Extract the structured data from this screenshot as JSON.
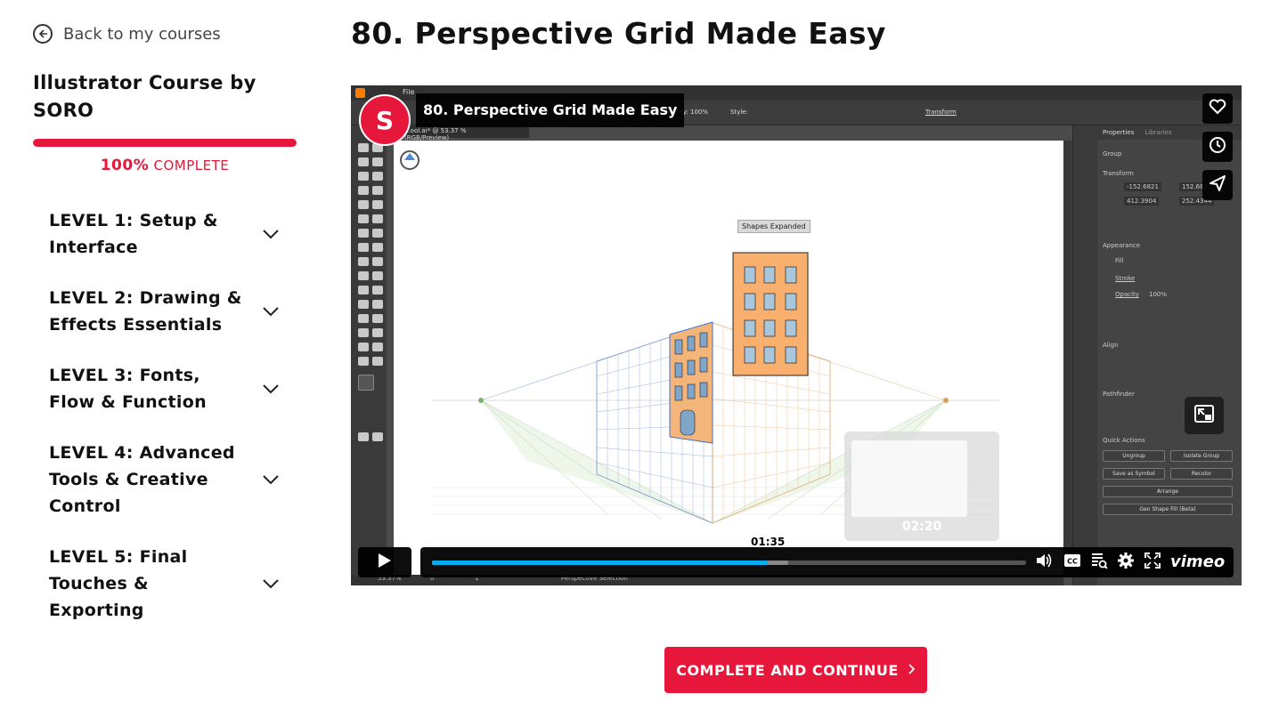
{
  "sidebar": {
    "back_label": "Back to my courses",
    "course_title": "Illustrator Course by SORO",
    "progress_fraction": 1.0,
    "progress_percent": "100%",
    "progress_word": "COMPLETE",
    "accent_color": "#e6173b",
    "levels": [
      {
        "label": "LEVEL 1: Setup & Interface"
      },
      {
        "label": "LEVEL 2: Drawing & Effects Essentials"
      },
      {
        "label": "LEVEL 3: Fonts, Flow & Function"
      },
      {
        "label": "LEVEL 4: Advanced Tools & Creative Control"
      },
      {
        "label": "LEVEL 5: Final Touches & Exporting"
      }
    ]
  },
  "lesson": {
    "title": "80. Perspective Grid Made Easy"
  },
  "player": {
    "overlay_title": "80. Perspective Grid Made Easy",
    "badge_logo_letter": "S",
    "current_time": "01:35",
    "preview_time": "02:20",
    "played_fraction": 0.565,
    "buffered_fraction": 0.6,
    "brand": "vimeo",
    "accent_color": "#00adef",
    "side_buttons": [
      "heart-icon",
      "clock-icon",
      "send-icon"
    ],
    "controls": [
      "volume-icon",
      "cc-icon",
      "chapters-icon",
      "settings-icon",
      "fullscreen-icon"
    ],
    "screen": {
      "menu_file": "File",
      "doc_tab": "...ool.ai* @ 53.37 % (RGB/Preview)",
      "tooltip": "Shapes Expanded",
      "zoom": "53.37%",
      "rotation": "0°",
      "artboard": "1",
      "status": "Perspective Selection",
      "props_tab_1": "Properties",
      "props_tab_2": "Libraries",
      "group_label": "Group",
      "transform_label": "Transform",
      "x_value": "-152.6821",
      "y_value": "412.3904",
      "w_value": "152.682",
      "h_value": "252.4344",
      "appearance_label": "Appearance",
      "fill_label": "Fill",
      "stroke_label": "Stroke",
      "opacity_label": "Opacity",
      "opacity_value": "100%",
      "align_label": "Align",
      "pathfinder_label": "Pathfinder",
      "quick_actions_label": "Quick Actions",
      "btn_ungroup": "Ungroup",
      "btn_isolate": "Isolate Group",
      "btn_symbol": "Save as Symbol",
      "btn_recolor": "Recolor",
      "btn_arrange": "Arrange",
      "btn_genshape": "Gen Shape Fill (Beta)",
      "opt_opacity": "Opacity: 100%",
      "opt_style": "Style:",
      "opt_transform": "Transform"
    }
  },
  "cta": {
    "label": "COMPLETE AND CONTINUE"
  }
}
